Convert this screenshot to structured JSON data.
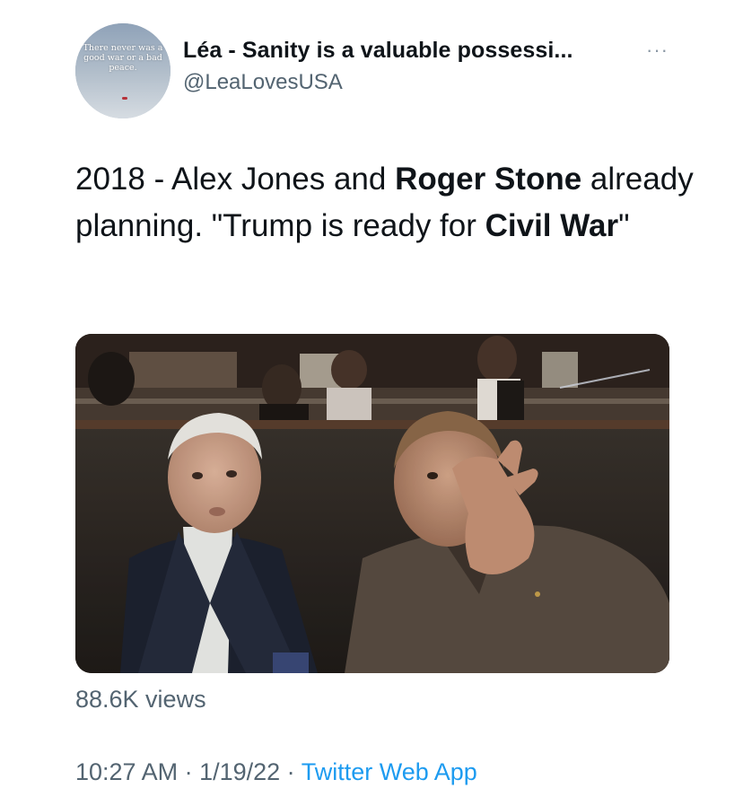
{
  "author": {
    "display_name": "Léa - Sanity is a valuable possessi...",
    "handle": "@LeaLovesUSA",
    "avatar_text": "There never was a good war or a bad peace."
  },
  "more_menu_icon": "more-dots-icon",
  "tweet": {
    "text_parts": [
      {
        "text": "2018  - Alex Jones and ",
        "bold": false
      },
      {
        "text": "Roger Stone",
        "bold": true
      },
      {
        "text": " already planning. \"Trump is ready for ",
        "bold": false
      },
      {
        "text": "Civil War",
        "bold": true
      },
      {
        "text": "\"",
        "bold": false
      }
    ]
  },
  "media": {
    "kind": "video-still",
    "description_icon": "photo"
  },
  "stats": {
    "views": "88.6K views"
  },
  "timestamp": {
    "time": "10:27 AM",
    "separator_1": " · ",
    "date": "1/19/22",
    "separator_2": " · ",
    "source": "Twitter Web App"
  },
  "colors": {
    "text": "#0f1419",
    "secondary": "#536471",
    "link": "#1d9bf0"
  }
}
